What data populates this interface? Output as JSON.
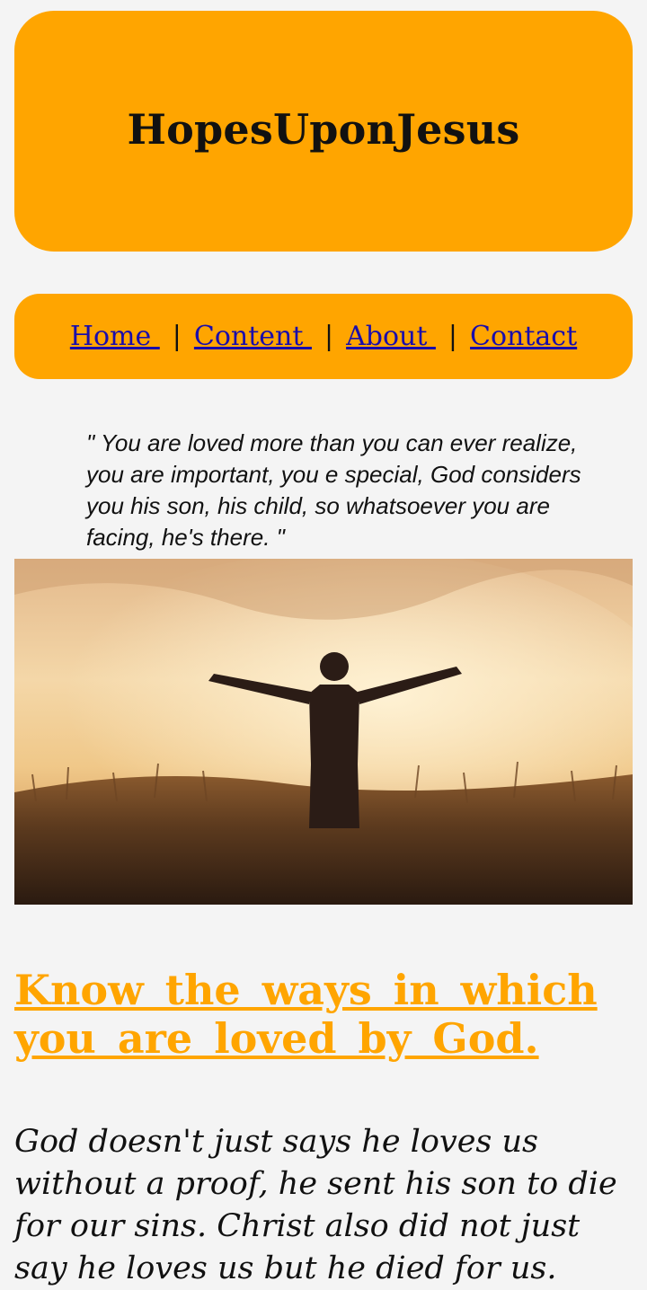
{
  "header": {
    "title": "HopesUponJesus"
  },
  "nav": {
    "items": [
      {
        "label": "Home "
      },
      {
        "label": "Content "
      },
      {
        "label": "About "
      },
      {
        "label": "Contact"
      }
    ],
    "separator": "|"
  },
  "quote": {
    "text": "\" You are loved more than you can ever realize, you are important, you e special, God considers you his son, his child, so whatsoever you are facing, he's there. \""
  },
  "hero_image": {
    "description": "person-arms-outstretched-in-field-at-sunset"
  },
  "article": {
    "heading": "Know the ways in which you are loved by God.",
    "body": "God doesn't just says he loves us without a proof, he sent his son to die for our sins. Christ also did not just say he loves us but he died for us."
  },
  "colors": {
    "accent": "#ffa500",
    "link": "#1a0dab",
    "background": "#f4f4f4"
  }
}
